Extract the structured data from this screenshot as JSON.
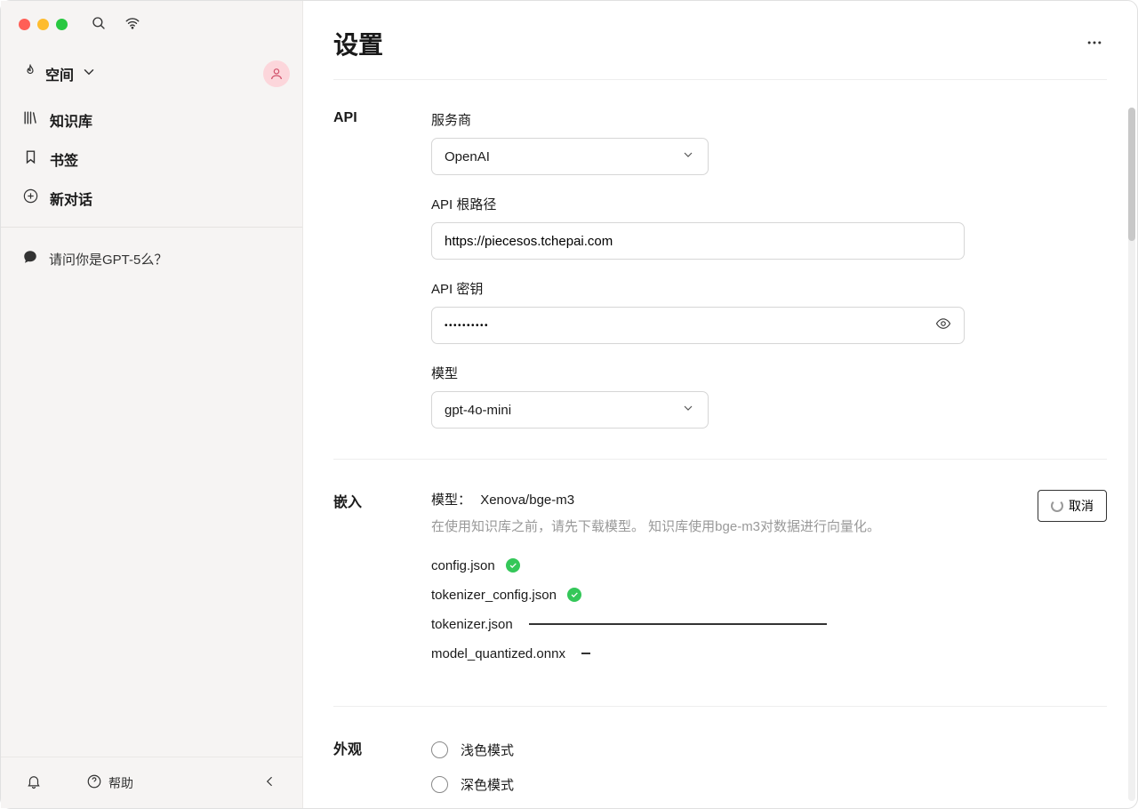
{
  "sidebar": {
    "space_label": "空间",
    "nav": {
      "knowledge": "知识库",
      "bookmarks": "书签",
      "new_chat": "新对话"
    },
    "chats": [
      {
        "title": "请问你是GPT-5么？"
      }
    ],
    "help_label": "帮助"
  },
  "page": {
    "title": "设置"
  },
  "api": {
    "section_label": "API",
    "provider_label": "服务商",
    "provider_value": "OpenAI",
    "base_url_label": "API 根路径",
    "base_url_value": "https://piecesos.tchepai.com",
    "api_key_label": "API 密钥",
    "api_key_value": "••••••••••",
    "model_label": "模型",
    "model_value": "gpt-4o-mini"
  },
  "embed": {
    "section_label": "嵌入",
    "model_label": "模型：",
    "model_value": "Xenova/bge-m3",
    "description": "在使用知识库之前，请先下载模型。 知识库使用bge-m3对数据进行向量化。",
    "cancel_label": "取消",
    "files": [
      {
        "name": "config.json",
        "status": "done"
      },
      {
        "name": "tokenizer_config.json",
        "status": "done"
      },
      {
        "name": "tokenizer.json",
        "status": "progress",
        "progress": 100
      },
      {
        "name": "model_quantized.onnx",
        "status": "progress",
        "progress": 1
      }
    ]
  },
  "appearance": {
    "section_label": "外观",
    "options": [
      "浅色模式",
      "深色模式"
    ]
  }
}
